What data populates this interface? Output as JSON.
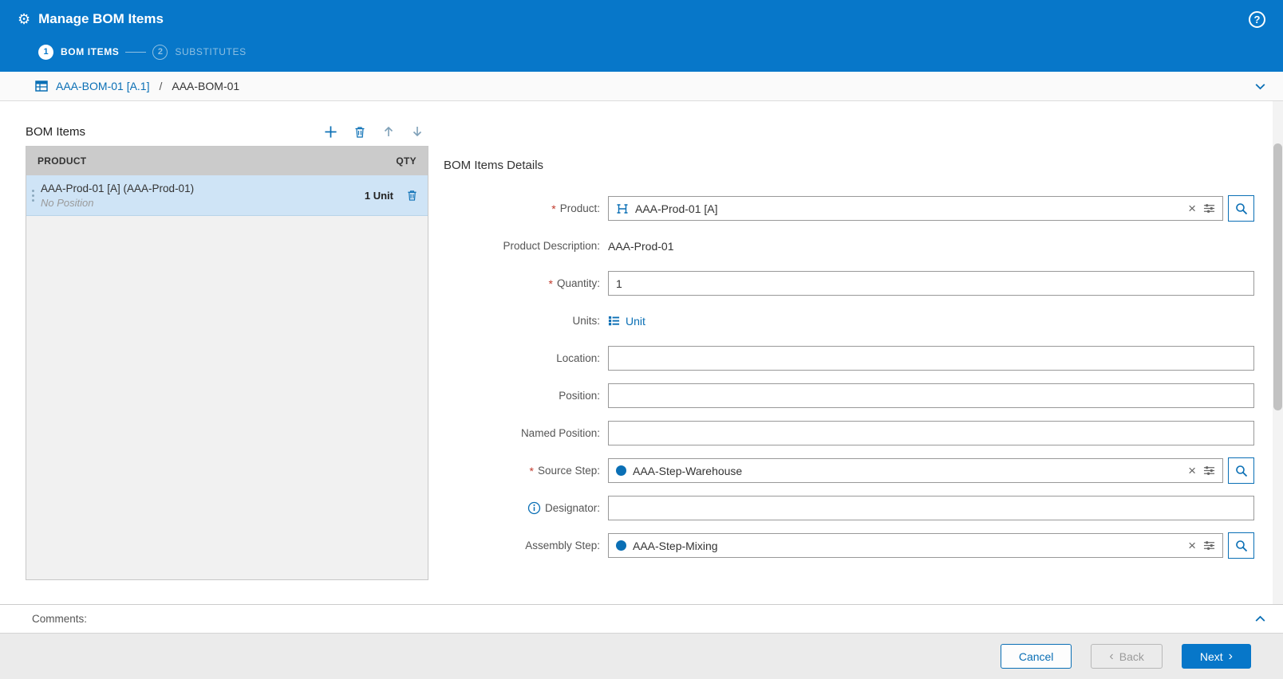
{
  "colors": {
    "header_blue": "#0777c9",
    "accent_blue": "#0a6fb5",
    "selected_row": "#cfe4f6",
    "required_red": "#c0392b",
    "footer_gray": "#ebebeb"
  },
  "icons": {
    "gear": "⚙",
    "help": "?",
    "clear": "×",
    "back_chevron": "‹",
    "next_chevron": "›"
  },
  "header": {
    "title": "Manage BOM Items"
  },
  "stepper": {
    "steps": [
      {
        "number": "1",
        "label": "BOM ITEMS",
        "active": true
      },
      {
        "number": "2",
        "label": "SUBSTITUTES",
        "active": false
      }
    ]
  },
  "breadcrumb": {
    "link": "AAA-BOM-01 [A.1]",
    "separator": "/",
    "current": "AAA-BOM-01"
  },
  "bom_list": {
    "title": "BOM Items",
    "header": {
      "product": "PRODUCT",
      "qty": "QTY"
    },
    "rows": [
      {
        "product": "AAA-Prod-01 [A] (AAA-Prod-01)",
        "position": "No Position",
        "qty": "1 Unit"
      }
    ]
  },
  "details": {
    "title": "BOM Items Details",
    "product": {
      "required": "*",
      "label": "Product:",
      "value": "AAA-Prod-01 [A]"
    },
    "product_description": {
      "label": "Product Description:",
      "value": "AAA-Prod-01"
    },
    "quantity": {
      "required": "*",
      "label": "Quantity:",
      "value": "1"
    },
    "units": {
      "label": "Units:",
      "value": "Unit"
    },
    "location": {
      "label": "Location:",
      "value": ""
    },
    "position": {
      "label": "Position:",
      "value": ""
    },
    "named_position": {
      "label": "Named Position:",
      "value": ""
    },
    "source_step": {
      "required": "*",
      "label": "Source Step:",
      "value": "AAA-Step-Warehouse"
    },
    "designator": {
      "label": "Designator:",
      "value": ""
    },
    "assembly_step": {
      "label": "Assembly Step:",
      "value": "AAA-Step-Mixing"
    }
  },
  "comments": {
    "label": "Comments:"
  },
  "footer": {
    "cancel": "Cancel",
    "back": "Back",
    "next": "Next"
  }
}
